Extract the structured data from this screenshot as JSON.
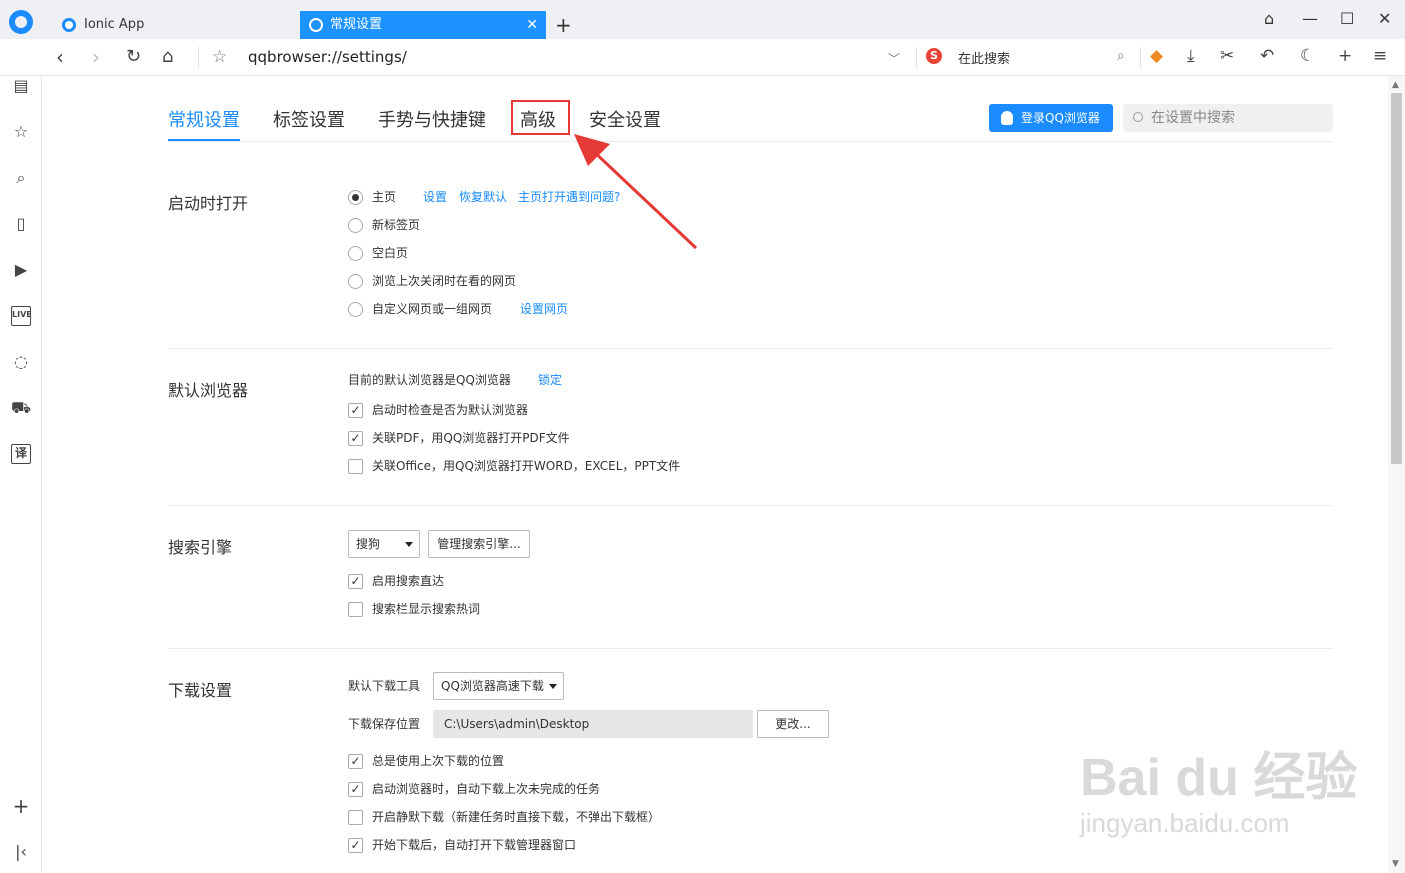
{
  "browser": {
    "tabs": [
      {
        "label": "Ionic App",
        "active": false
      },
      {
        "label": "常规设置",
        "active": true
      }
    ],
    "close_glyph": "✕",
    "new_tab_glyph": "+",
    "url": "qqbrowser://settings/",
    "search_hint": "在此搜索",
    "search_engine_icon": "S"
  },
  "settings": {
    "tabs": [
      "常规设置",
      "标签设置",
      "手势与快捷键",
      "高级",
      "安全设置"
    ],
    "active_tab": "常规设置",
    "highlighted_tab": "高级",
    "login_button": "登录QQ浏览器",
    "search_placeholder": "在设置中搜索",
    "startup": {
      "title": "启动时打开",
      "options": [
        "主页",
        "新标签页",
        "空白页",
        "浏览上次关闭时在看的网页",
        "自定义网页或一组网页"
      ],
      "links": [
        "设置",
        "恢复默认",
        "主页打开遇到问题?"
      ],
      "custom_link": "设置网页",
      "selected": "主页"
    },
    "default_browser": {
      "title": "默认浏览器",
      "status": "目前的默认浏览器是QQ浏览器",
      "lock": "锁定",
      "options": [
        {
          "label": "启动时检查是否为默认浏览器",
          "checked": true
        },
        {
          "label": "关联PDF，用QQ浏览器打开PDF文件",
          "checked": true
        },
        {
          "label": "关联Office，用QQ浏览器打开WORD，EXCEL，PPT文件",
          "checked": false
        }
      ]
    },
    "search_engine": {
      "title": "搜索引擎",
      "selected": "搜狗",
      "manage": "管理搜索引擎...",
      "options": [
        {
          "label": "启用搜索直达",
          "checked": true
        },
        {
          "label": "搜索栏显示搜索热词",
          "checked": false
        }
      ]
    },
    "download": {
      "title": "下载设置",
      "tool_label": "默认下载工具",
      "tool_value": "QQ浏览器高速下载",
      "path_label": "下载保存位置",
      "path_value": "C:\\Users\\admin\\Desktop",
      "change": "更改...",
      "options": [
        {
          "label": "总是使用上次下载的位置",
          "checked": true
        },
        {
          "label": "启动浏览器时，自动下载上次未完成的任务",
          "checked": true
        },
        {
          "label": "开启静默下载（新建任务时直接下载，不弹出下载框）",
          "checked": false
        },
        {
          "label": "开始下载后，自动打开下载管理器窗口",
          "checked": true
        }
      ]
    }
  },
  "check_glyph": "✓",
  "watermark": {
    "line1": "Bai du 经验",
    "line2": "jingyan.baidu.com"
  },
  "colors": {
    "accent": "#1a8cff",
    "highlight": "#e53935",
    "tab_active": "#1d93ff"
  }
}
